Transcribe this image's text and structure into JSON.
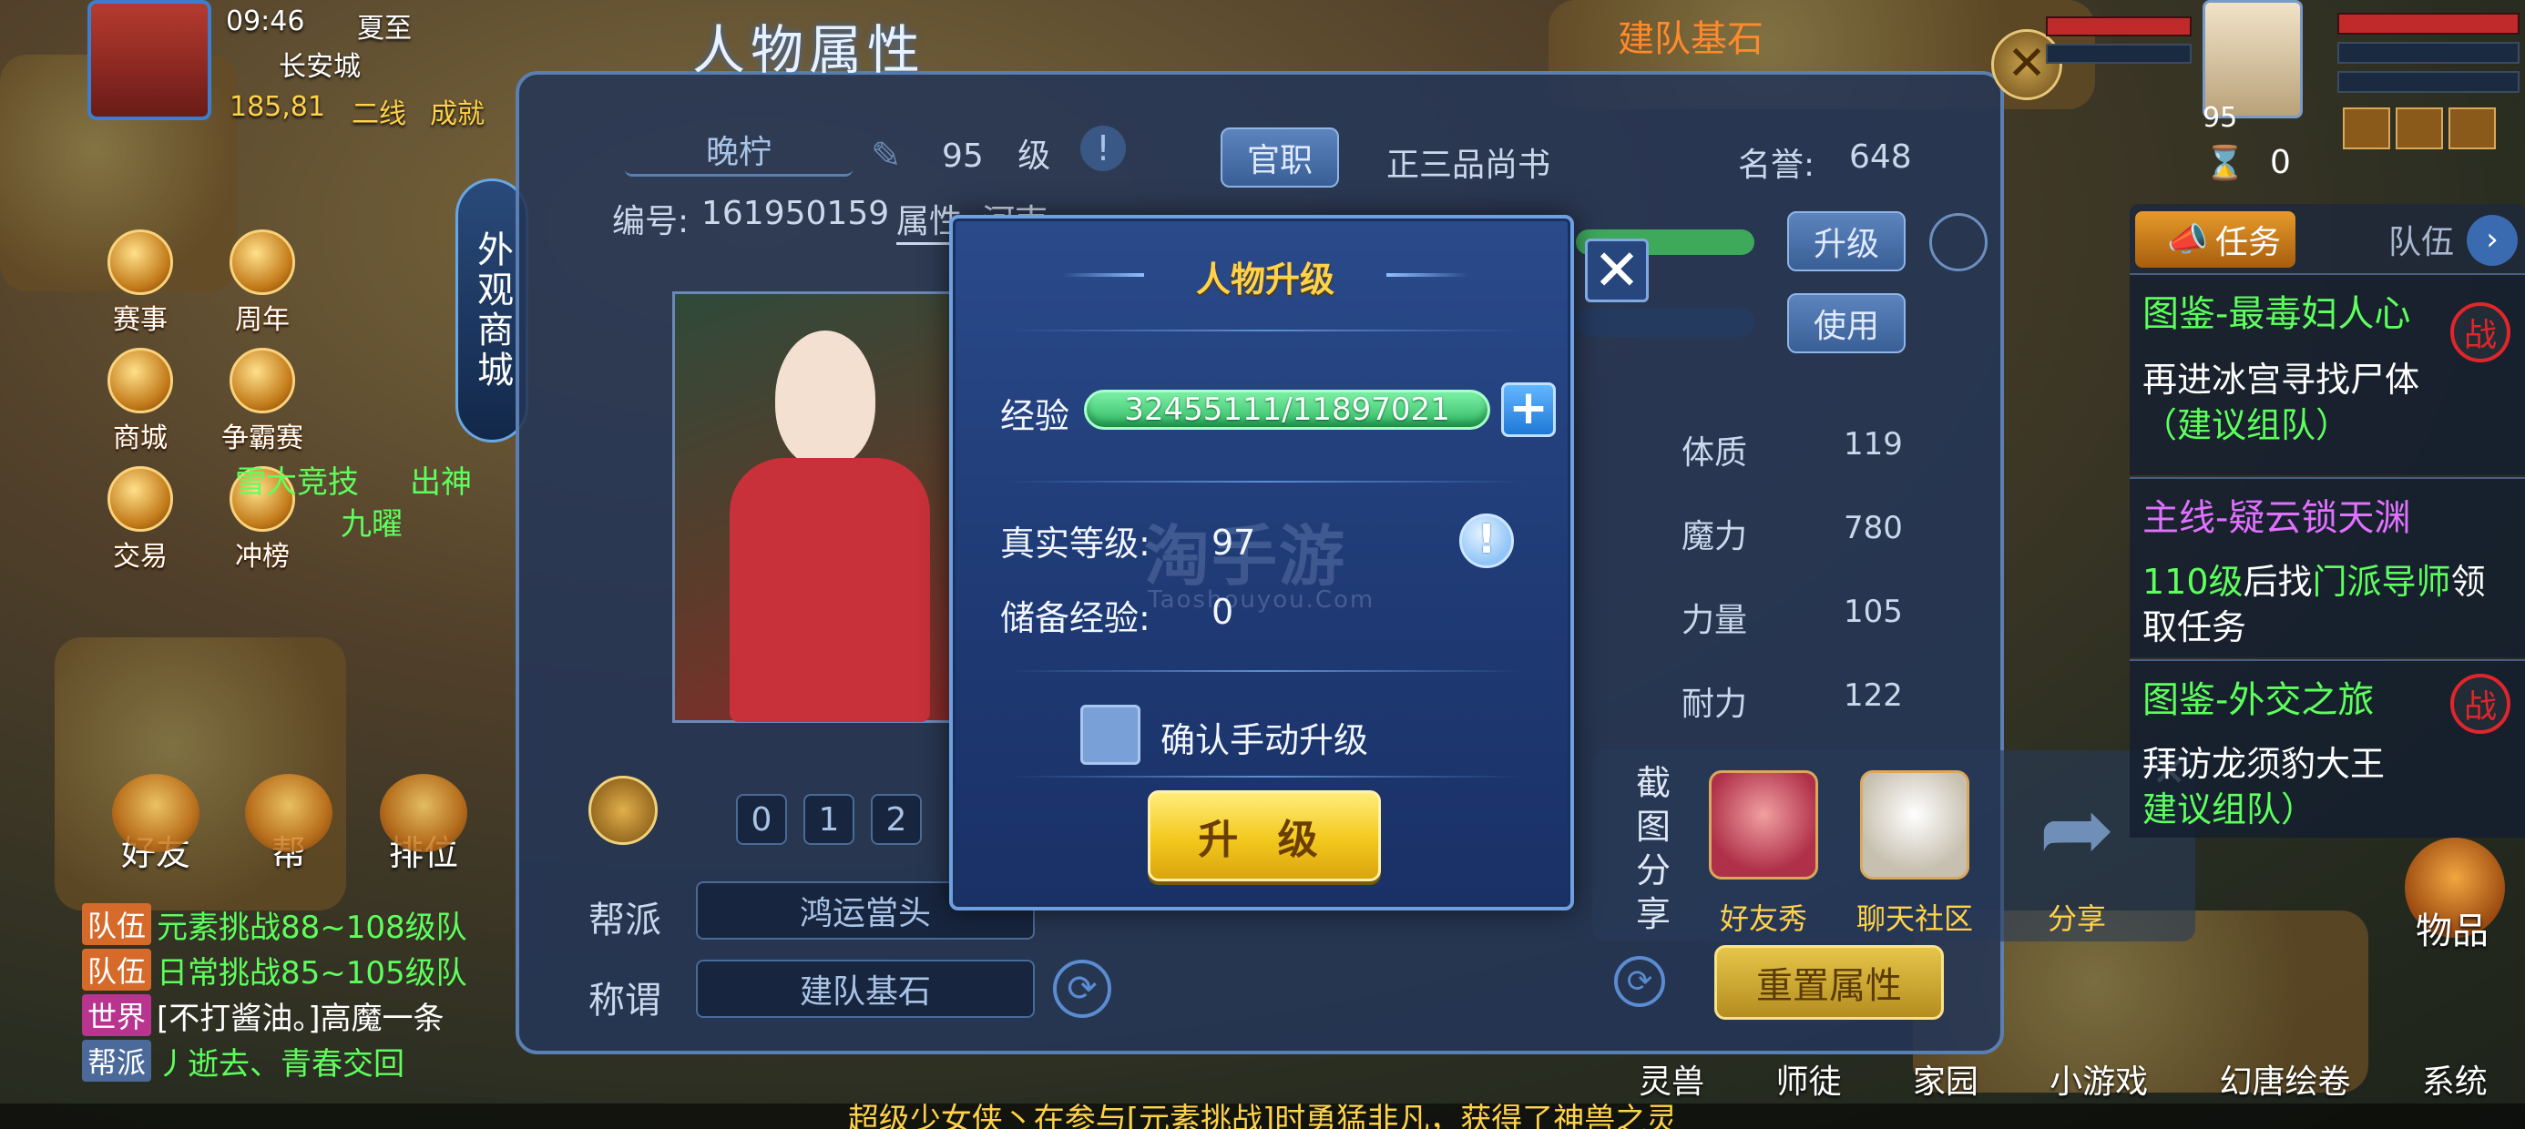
{
  "status": {
    "time": "09:46",
    "solar_term": "夏至",
    "location": "长安城",
    "coords": "185,81",
    "line": "二线",
    "achievement": "成就"
  },
  "left_icons": [
    {
      "label": "赛事"
    },
    {
      "label": "周年"
    },
    {
      "label": "商城"
    },
    {
      "label": "争霸赛"
    },
    {
      "label": "交易"
    },
    {
      "label": "冲榜"
    }
  ],
  "store_pill": "外观商城",
  "left_npc_texts": {
    "line1": "雪大竞技",
    "line2": "出神",
    "line3": "九曜"
  },
  "bottom_left_buttons": [
    "好友",
    "帮",
    "排位"
  ],
  "chat": [
    {
      "tag": "队伍",
      "tag_color": "#d56a2b",
      "text": "元素挑战88~108级队",
      "color": "#5dff5d"
    },
    {
      "tag": "队伍",
      "tag_color": "#d56a2b",
      "text": "日常挑战85~105级队",
      "color": "#5dff5d"
    },
    {
      "tag": "世界",
      "tag_color": "#b9348f",
      "text": "[不打酱油。]高魔一条",
      "color": "#ffffff"
    },
    {
      "tag": "帮派",
      "tag_color": "#4b6a9a",
      "text": "丿逝去、青春交回",
      "color": "#5dff5d"
    }
  ],
  "attr_panel": {
    "title": "人物属性",
    "name": "晚柠",
    "level_num": "95",
    "level_unit": "级",
    "office_btn": "官职",
    "rank": "正三品尚书",
    "fame_label": "名誉:",
    "fame_value": "648",
    "id_label": "编号:",
    "id_value": "161950159",
    "attr_tab": "属性",
    "river_tab": "河南",
    "upgrade_btn": "升级",
    "use_btn": "使用",
    "bar_value": "30",
    "stats": [
      {
        "label": "体质",
        "value": "119"
      },
      {
        "label": "魔力",
        "value": "780"
      },
      {
        "label": "力量",
        "value": "105"
      },
      {
        "label": "耐力",
        "value": "122"
      }
    ],
    "pages": [
      "0",
      "1",
      "2"
    ],
    "guild_label": "帮派",
    "guild_value": "鸿运當头",
    "title_label": "称谓",
    "title_value": "建队基石",
    "reset_btn": "重置属性",
    "top_bar_text": "建队基石"
  },
  "dialog": {
    "title": "人物升级",
    "exp_label": "经验",
    "exp_value": "32455111/11897021",
    "real_level_label": "真实等级:",
    "real_level_value": "97",
    "reserve_exp_label": "储备经验:",
    "reserve_exp_value": "0",
    "confirm_label": "确认手动升级",
    "upgrade_btn": "升 级",
    "watermark": "淘手游",
    "watermark_sub": "Taoshouyou.Com"
  },
  "top_right": {
    "level": "95",
    "count": "0"
  },
  "tasks": {
    "tab_task": "任务",
    "tab_team": "队伍",
    "items": [
      {
        "title": "图鉴-最毒妇人心",
        "title_color": "#5dff5d",
        "desc": "再进冰宫寻找尸体",
        "hint": "（建议组队）",
        "badge": "战"
      },
      {
        "title": "主线-疑云锁天渊",
        "title_color": "#e071ff",
        "desc_prefix": "110级",
        "desc_mid": "后找",
        "desc_npc": "门派导师",
        "desc_suffix": "领取任务"
      },
      {
        "title": "图鉴-外交之旅",
        "title_color": "#5dff5d",
        "desc": "拜访龙须豹大王",
        "hint": "建议组队）",
        "badge": "战"
      }
    ]
  },
  "share": {
    "title": "截图分享",
    "items": [
      {
        "label": "好友秀"
      },
      {
        "label": "聊天社区"
      },
      {
        "label": "分享"
      }
    ]
  },
  "bottom_right_buttons": [
    "灵兽",
    "师徒",
    "家园",
    "小游戏",
    "幻唐绘卷",
    "系统"
  ],
  "bag_label": "物品",
  "marquee": "超级少女侠丶在参与[元素挑战]时勇猛非凡，获得了神兽之灵"
}
